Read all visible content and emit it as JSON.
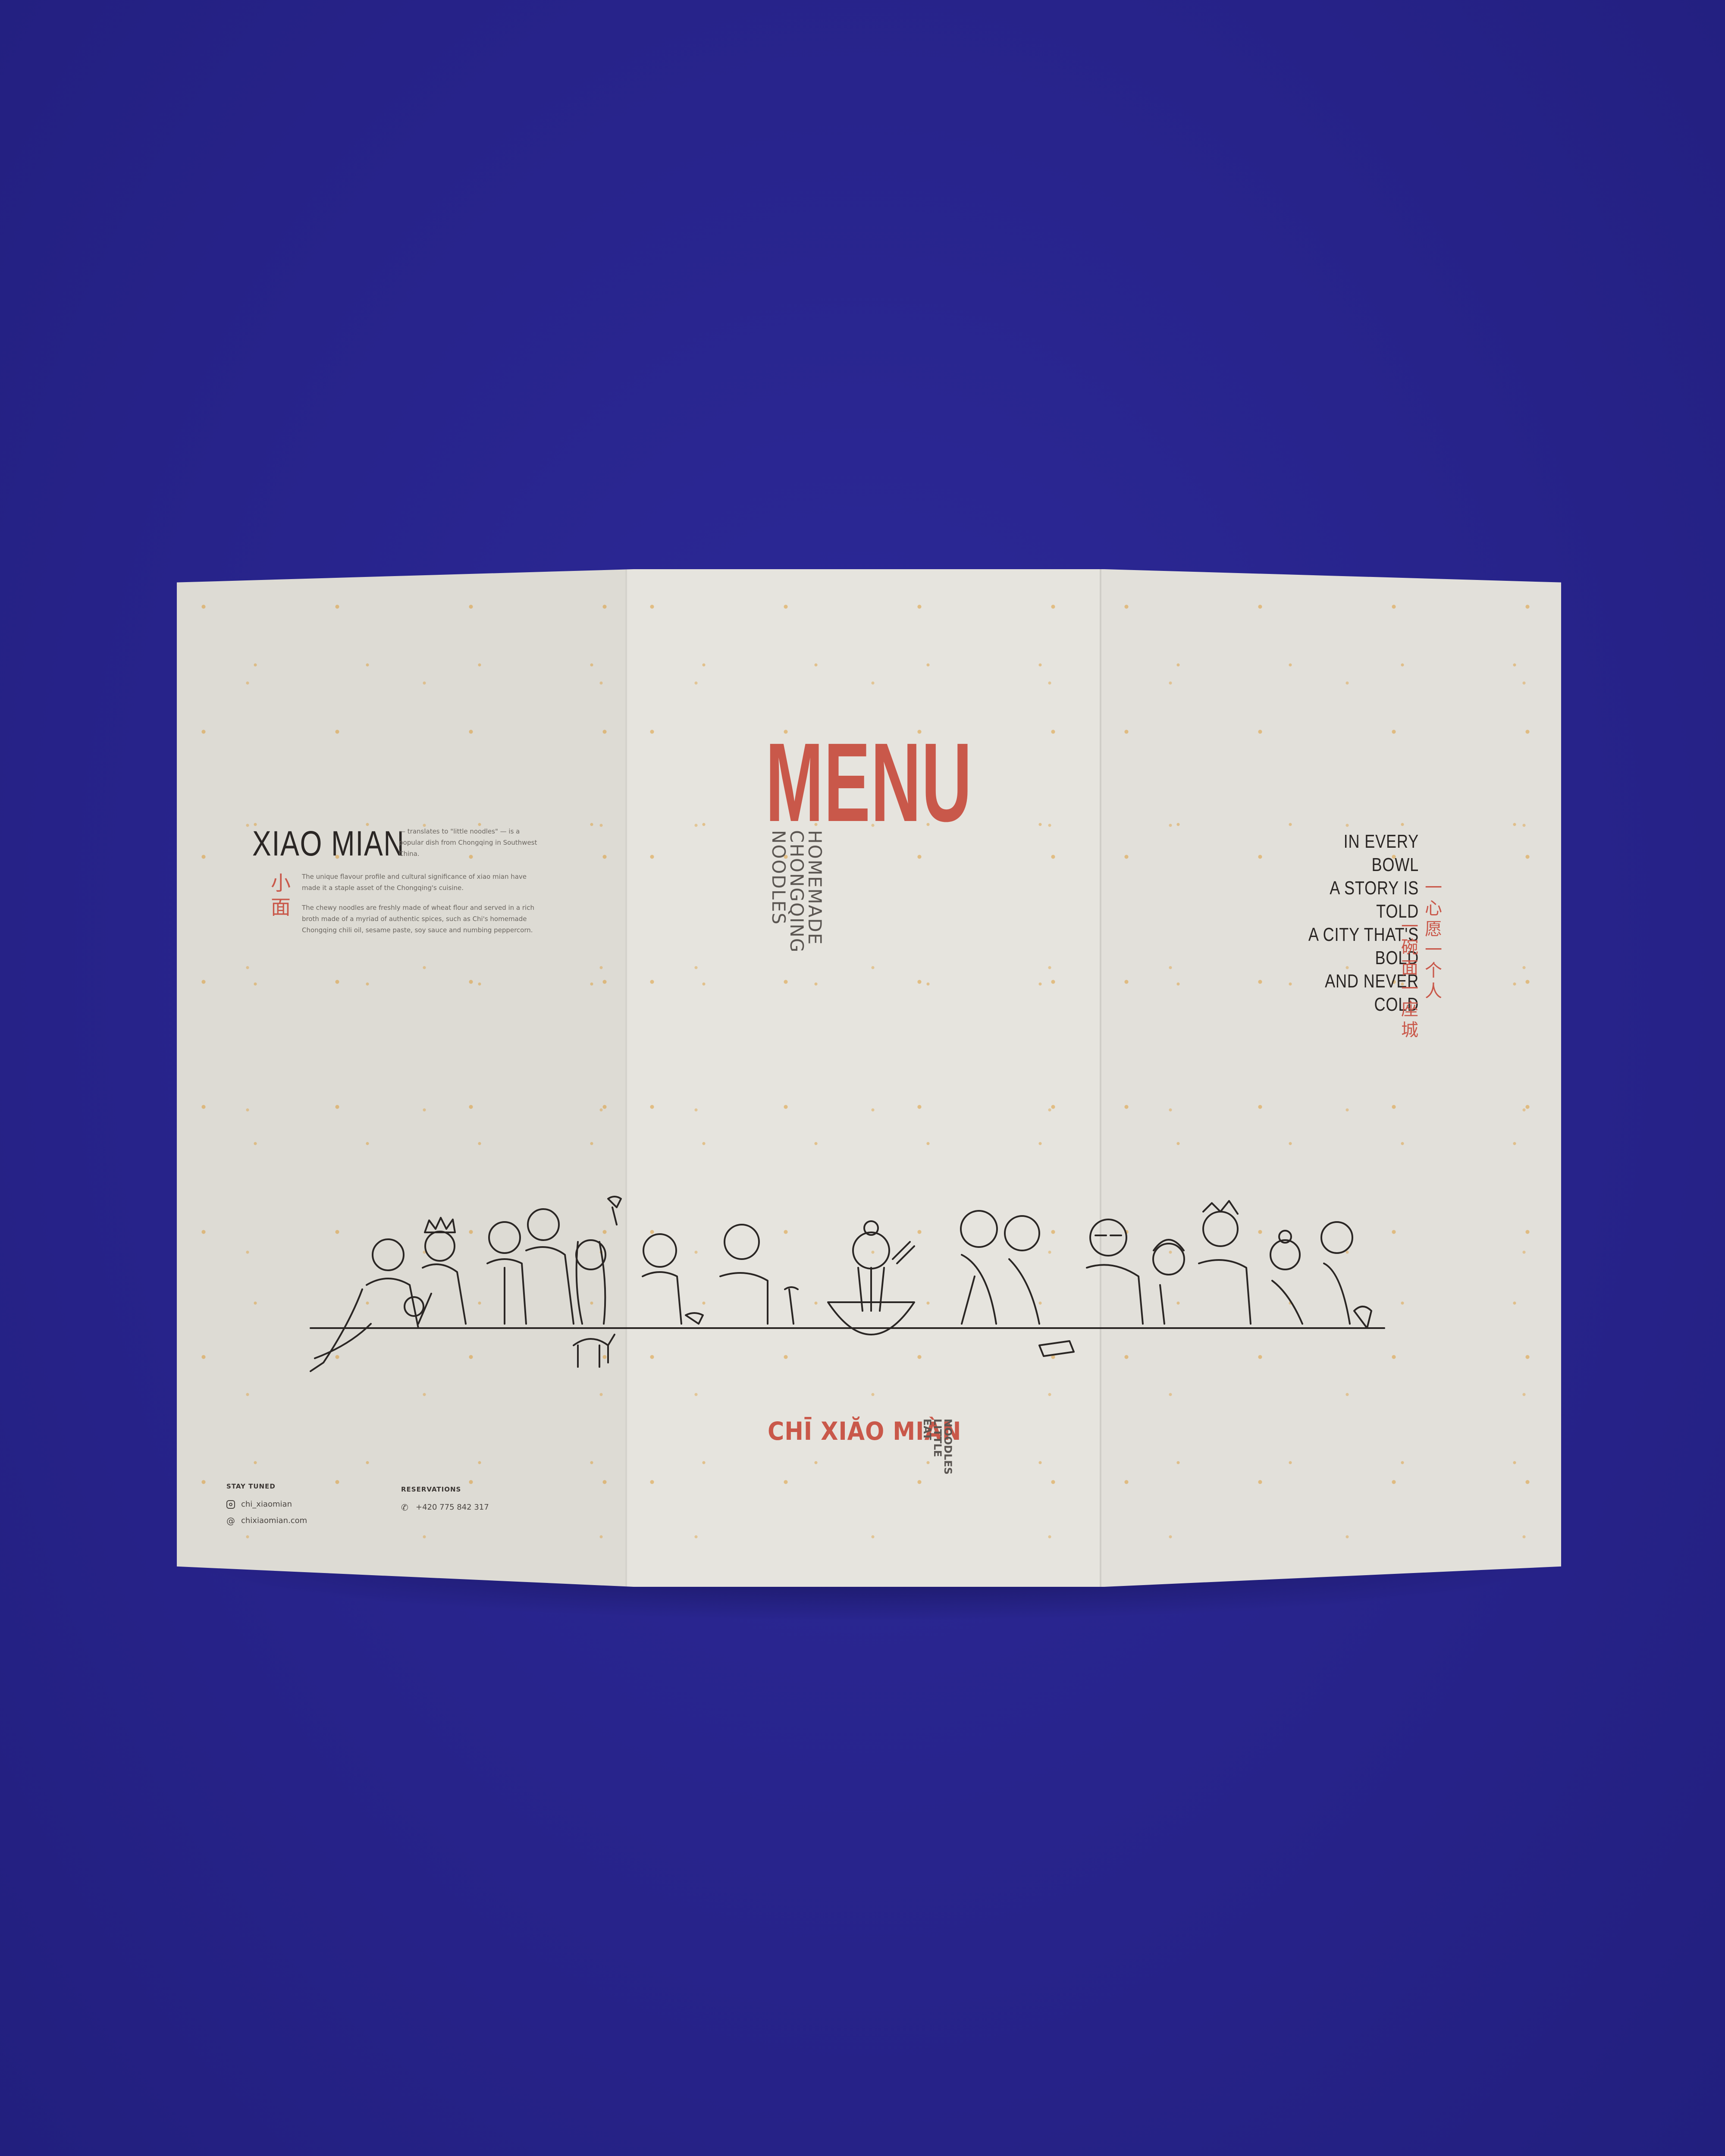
{
  "left_panel": {
    "title": "XIAO MIAN",
    "title_hanzi": "小面",
    "para_1": "— translates to \"little noodles\" — is a popular dish from Chongqing in Southwest China.",
    "para_2": "The unique flavour profile and cultural significance of xiao mian have made it a staple asset of the Chongqing's cuisine.",
    "para_3": "The chewy noodles are freshly made of wheat flour and served in a rich broth made of a myriad of authentic spices, such as Chi's homemade Chongqing chili oil, sesame paste, soy sauce and numbing peppercorn.",
    "stay_tuned_label": "STAY TUNED",
    "instagram": "chi_xiaomian",
    "website": "chixiaomian.com",
    "reservations_label": "RESERVATIONS",
    "phone": "+420 775 842 317"
  },
  "middle_panel": {
    "title": "MENU",
    "subtitle_lines": [
      "HOMEMADE",
      "CHONGQING",
      "NOODLES"
    ],
    "brand": "CHĪ XIĂO MIÀN",
    "brand_sub_lines": [
      "EAT",
      "LITTLE",
      "NOODLES"
    ]
  },
  "right_panel": {
    "poem": [
      "IN EVERY BOWL",
      "A STORY IS TOLD",
      "A CITY THAT'S BOLD",
      "AND NEVER COLD"
    ],
    "vertical_cn_1": "一心愿一个人",
    "vertical_cn_2": "一碗面一座城"
  },
  "colors": {
    "background": "#2a2690",
    "paper": "#e3e1db",
    "accent_red": "#c9584a",
    "ink": "#2a2624"
  },
  "icons": [
    "instagram-icon",
    "globe-icon",
    "phone-icon"
  ]
}
